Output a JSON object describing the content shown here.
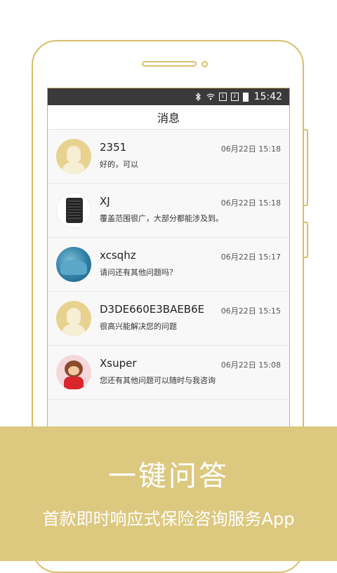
{
  "status_bar": {
    "time": "15:42",
    "icons": [
      "bluetooth-icon",
      "wifi-icon",
      "sim1-icon",
      "sim2-icon",
      "battery-charging-icon"
    ]
  },
  "header": {
    "title": "消息"
  },
  "messages": [
    {
      "name": "2351",
      "time": "06月22日 15:18",
      "text": "好的，可以",
      "avatar": "default-avatar"
    },
    {
      "name": "XJ",
      "time": "06月22日 15:18",
      "text": "覆盖范围很广，大部分都能涉及到。",
      "avatar": "server-avatar"
    },
    {
      "name": "xcsqhz",
      "time": "06月22日 15:17",
      "text": "请问还有其他问题吗？",
      "avatar": "sea-avatar"
    },
    {
      "name": "D3DE660E3BAEB6E...",
      "time": "06月22日 15:15",
      "text": "很高兴能解决您的问题",
      "avatar": "default-avatar"
    },
    {
      "name": "Xsuper",
      "time": "06月22日 15:08",
      "text": "您还有其他问题可以随时与我咨询",
      "avatar": "monkey-avatar"
    }
  ],
  "banner": {
    "headline": "一键问答",
    "subline": "首款即时响应式保险咨询服务App"
  },
  "colors": {
    "accent": "#dcc87f",
    "frame": "#d9bf6a",
    "statusbar": "#3a3a3a"
  }
}
